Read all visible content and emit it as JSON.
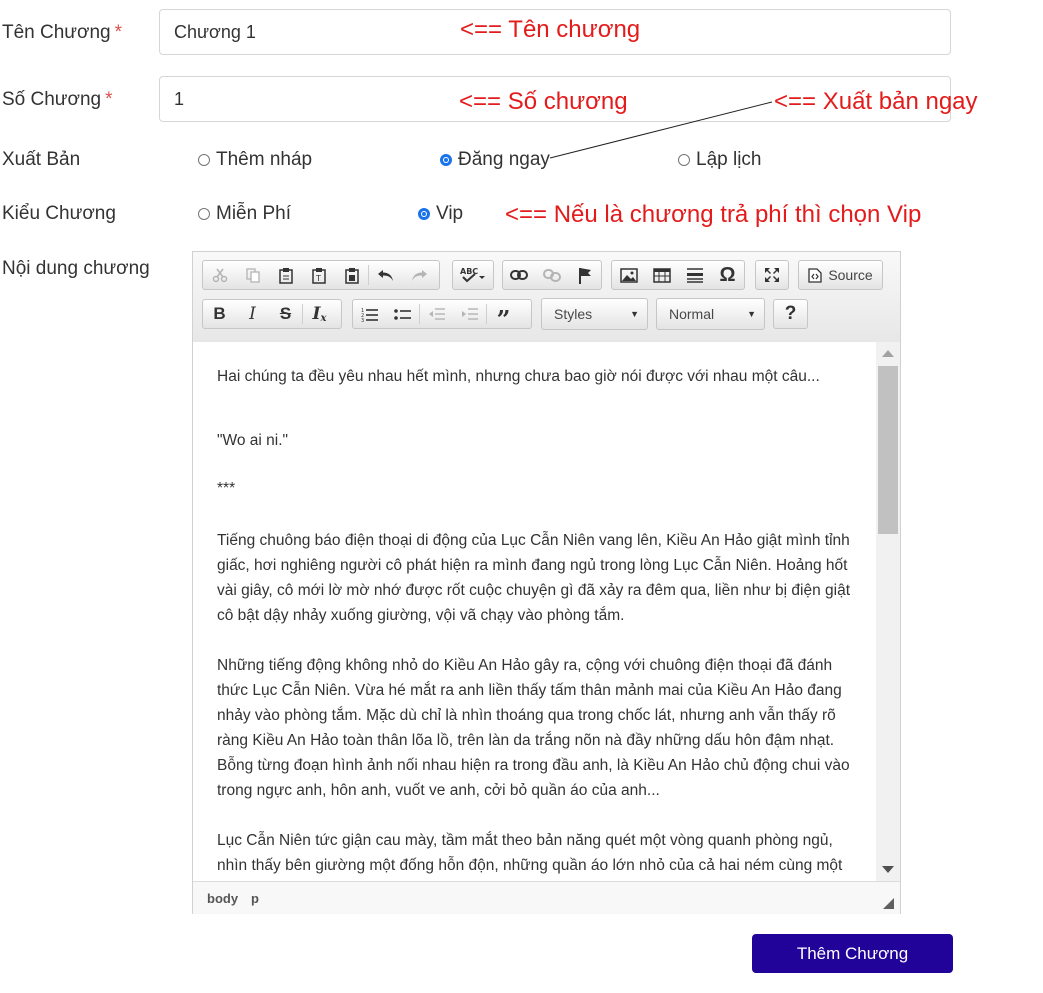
{
  "form": {
    "ten_chuong_label": "Tên Chương",
    "so_chuong_label": "Số Chương",
    "required_mark": "*",
    "ten_chuong_value": "Chương 1",
    "so_chuong_value": "1",
    "xuat_ban_label": "Xuất Bản",
    "xuat_ban_options": [
      "Thêm nháp",
      "Đăng ngay",
      "Lập lịch"
    ],
    "xuat_ban_selected": "Đăng ngay",
    "kieu_chuong_label": "Kiểu Chương",
    "kieu_chuong_options": [
      "Miễn Phí",
      "Vip"
    ],
    "kieu_chuong_selected": "Vip",
    "noi_dung_label": "Nội dung chương",
    "submit_label": "Thêm Chương"
  },
  "annotations": {
    "ten_chuong": "<== Tên chương",
    "so_chuong": "<== Số chương",
    "xuat_ban": "<== Xuất bản ngay",
    "vip": "<== Nếu là chương trả phí thì chọn Vip"
  },
  "editor": {
    "toolbar_icons": [
      "cut-icon",
      "copy-icon",
      "paste-icon",
      "paste-text-icon",
      "paste-word-icon",
      "undo-icon",
      "redo-icon",
      "spellcheck-icon",
      "link-icon",
      "unlink-icon",
      "anchor-icon",
      "image-icon",
      "table-icon",
      "horizontal-rule-icon",
      "special-char-icon",
      "maximize-icon",
      "source-icon",
      "bold-icon",
      "italic-icon",
      "strike-icon",
      "remove-format-icon",
      "numbered-list-icon",
      "bulleted-list-icon",
      "outdent-icon",
      "indent-icon",
      "blockquote-icon",
      "help-icon"
    ],
    "source_label": "Source",
    "styles_label": "Styles",
    "format_label": "Normal",
    "help_label": "?",
    "paragraphs": [
      "Hai chúng ta đều yêu nhau hết mình, nhưng chưa bao giờ nói được với nhau một câu...",
      "\"Wo ai ni.\"",
      "***",
      "Tiếng chuông báo điện thoại di động của Lục Cẫn Niên vang lên, Kiều An Hảo giật mình tỉnh giấc, hơi nghiêng người cô phát hiện ra mình đang ngủ trong lòng Lục Cẫn Niên. Hoảng hốt vài giây, cô mới lờ mờ nhớ được rốt cuộc chuyện gì đã xảy ra đêm qua, liền như bị điện giật cô bật dậy nhảy xuống giường, vội vã chạy vào phòng tắm.",
      "Những tiếng động không nhỏ do Kiều An Hảo gây ra, cộng với chuông điện thoại đã đánh thức Lục Cẫn Niên. Vừa hé mắt ra anh liền thấy tấm thân mảnh mai của Kiều An Hảo đang nhảy vào phòng tắm. Mặc dù chỉ là nhìn thoáng qua trong chốc lát, nhưng anh vẫn thấy rõ ràng Kiều An Hảo toàn thân lõa lồ, trên làn da trắng nõn nà đầy những dấu hôn đậm nhạt. Bỗng từng đoạn hình ảnh nối nhau hiện ra trong đầu anh, là Kiều An Hảo chủ động chui vào trong ngực anh, hôn anh, vuốt ve anh, cởi bỏ quần áo của anh...",
      "Lục Cẫn Niên tức giận cau mày, tầm mắt theo bản năng quét một vòng quanh phòng ngủ, nhìn thấy bên giường một đống hỗn độn, những quần áo lớn nhỏ của cả hai ném cùng một"
    ],
    "path_body": "body",
    "path_p": "p"
  },
  "colors": {
    "annotation": "#e31b1b",
    "submit_bg": "#21039a",
    "required": "#d9534f",
    "radio_checked": "#1a73e8"
  }
}
